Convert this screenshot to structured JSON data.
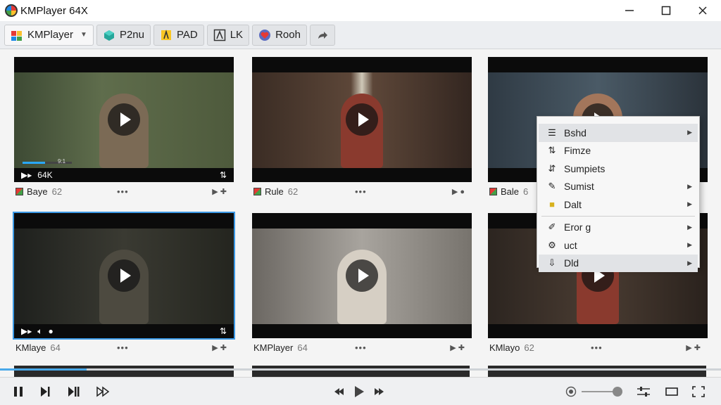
{
  "window": {
    "title": "KMPlayer 64X"
  },
  "toolbar": {
    "tabs": [
      {
        "label": "KMPlayer",
        "icon": "kmplayer-logo-icon"
      },
      {
        "label": "P2nu",
        "icon": "cube-icon"
      },
      {
        "label": "PAD",
        "icon": "pad-icon"
      },
      {
        "label": "LK",
        "icon": "lk-icon"
      },
      {
        "label": "Rooh",
        "icon": "heart-icon"
      }
    ],
    "share_icon": "share-arrow-icon"
  },
  "grid": {
    "cards": [
      {
        "title": "Baye",
        "num": "62",
        "overlay_text": "64K",
        "progress_label": "9:1",
        "progress": 0.45
      },
      {
        "title": "Rule",
        "num": "62"
      },
      {
        "title": "Bale",
        "num": "6"
      },
      {
        "title": "KMlaye",
        "num": "64"
      },
      {
        "title": "KMPlayer",
        "num": "64"
      },
      {
        "title": "KMlayo",
        "num": "62"
      }
    ]
  },
  "context_menu": {
    "items": [
      {
        "label": "Bshd",
        "icon": "list-icon",
        "submenu": true
      },
      {
        "label": "Fimze",
        "icon": "arrows-icon",
        "submenu": false
      },
      {
        "label": "Sumpiets",
        "icon": "sort-icon",
        "submenu": false
      },
      {
        "label": "Sumist",
        "icon": "pen-icon",
        "submenu": true
      },
      {
        "label": "Dalt",
        "icon": "folder-icon",
        "submenu": true
      },
      {
        "label": "Eror g",
        "icon": "edit-icon",
        "submenu": true
      },
      {
        "label": "uct",
        "icon": "gear-icon",
        "submenu": true
      },
      {
        "label": "Dld",
        "icon": "download-icon",
        "submenu": true
      }
    ]
  },
  "player": {
    "progress": 0.12
  },
  "colors": {
    "accent": "#3b98e5",
    "window_bg": "#f3f3f3"
  }
}
